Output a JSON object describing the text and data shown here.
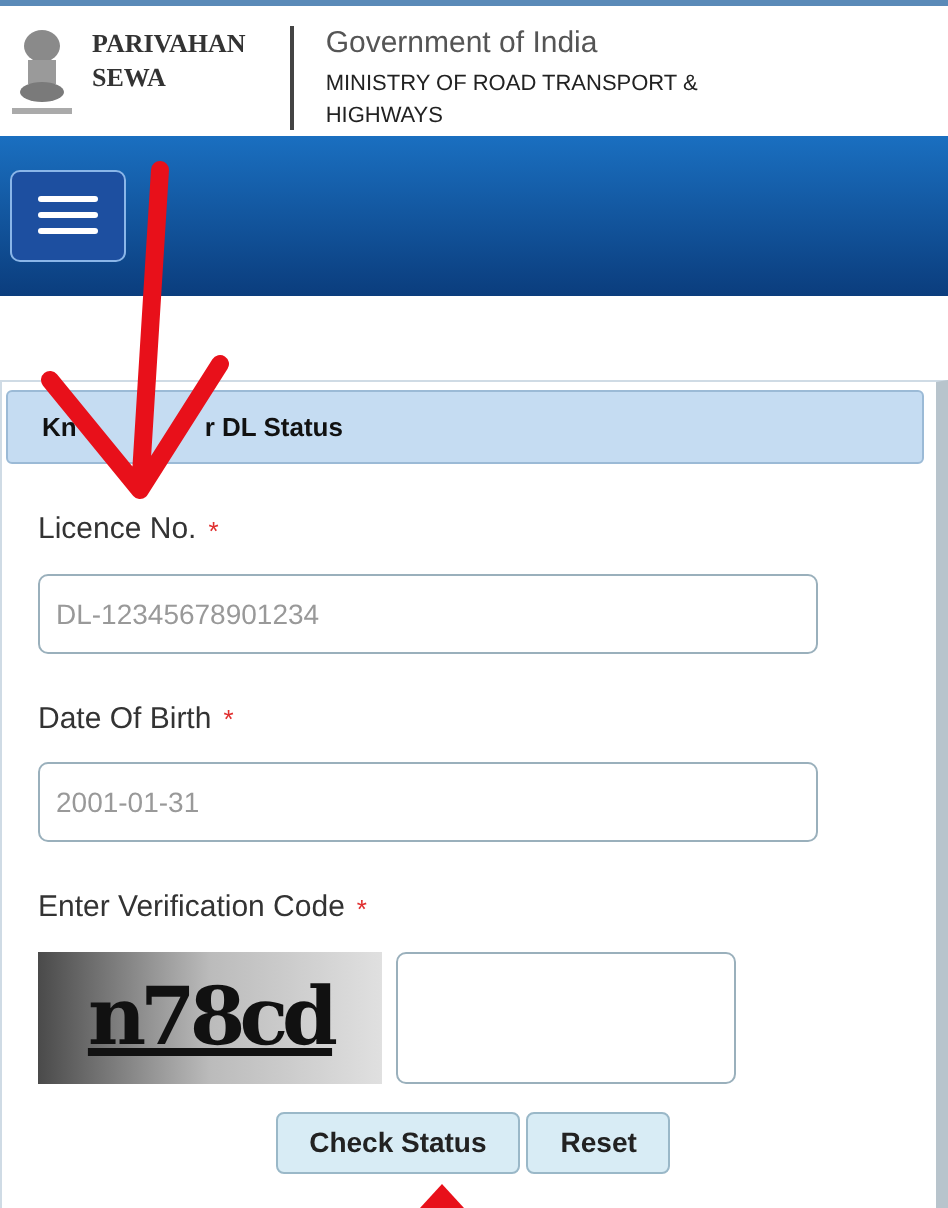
{
  "header": {
    "brand": [
      "PARIVAHAN",
      "SEWA"
    ],
    "government": "Government of India",
    "ministry": [
      "MINISTRY OF ROAD TRANSPORT &",
      "HIGHWAYS"
    ]
  },
  "form": {
    "title_start": "Kn",
    "title_end": "r DL Status",
    "fields": [
      {
        "kind": "text",
        "label": "Licence No.",
        "required": "*",
        "placeholder": "DL-12345678901234"
      },
      {
        "kind": "text",
        "label": "Date Of Birth",
        "required": "*",
        "placeholder": "2001-01-31"
      },
      {
        "kind": "captcha",
        "label": "Enter Verification Code",
        "required": "*",
        "captcha": "n78cd"
      }
    ],
    "buttons": [
      "Check Status",
      "Reset"
    ]
  }
}
